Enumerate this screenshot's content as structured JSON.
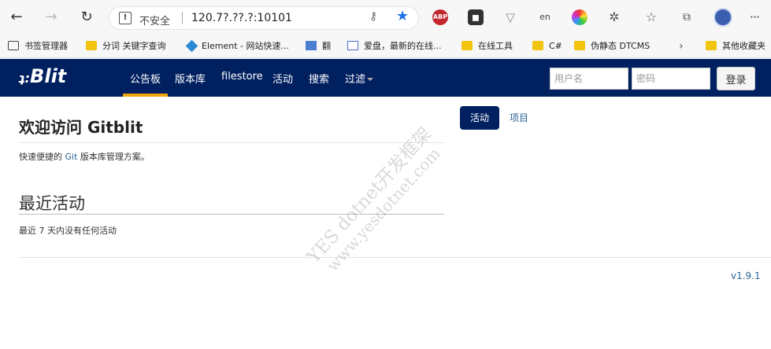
{
  "browser": {
    "insecure_label": "不安全",
    "url": "120.7?.??.?:10101",
    "extensions": {
      "abp": "ABP",
      "en": "en"
    },
    "bookmarks": [
      {
        "label": "书签管理器"
      },
      {
        "label": "分词 关键字查询"
      },
      {
        "label": "Element - 网站快速..."
      },
      {
        "label": "翻"
      },
      {
        "label": "爱盘，最新的在线..."
      },
      {
        "label": "在线工具"
      },
      {
        "label": "C#"
      },
      {
        "label": "伪静态 DTCMS"
      },
      {
        "label": "其他收藏夹"
      }
    ],
    "more_bookmarks": "›"
  },
  "app": {
    "logo_prefix": "ʇ:",
    "logo": "Blit",
    "nav": [
      {
        "label": "公告板",
        "active": true
      },
      {
        "label": "版本库"
      },
      {
        "label": "filestore"
      },
      {
        "label": "活动"
      },
      {
        "label": "搜索"
      },
      {
        "label": "过滤"
      }
    ],
    "login": {
      "username_placeholder": "用户名",
      "password_placeholder": "密码",
      "button": "登录"
    }
  },
  "main": {
    "welcome": "欢迎访问 Gitblit",
    "subtitle_prefix": "快速便捷的 ",
    "subtitle_git": "Git",
    "subtitle_suffix": " 版本库管理方案。",
    "recent_title": "最近活动",
    "recent_empty": "最近 7 天内没有任何活动",
    "tabs": [
      {
        "label": "活动",
        "active": true
      },
      {
        "label": "项目"
      }
    ]
  },
  "footer": {
    "version": "v1.9.1"
  },
  "watermark": {
    "line1": "YES  dotnet开发框架",
    "line2": "www.yesdotnet.com"
  },
  "colors": {
    "nav_bg": "#002060",
    "accent": "#f0a30a",
    "link": "#2a6496"
  }
}
